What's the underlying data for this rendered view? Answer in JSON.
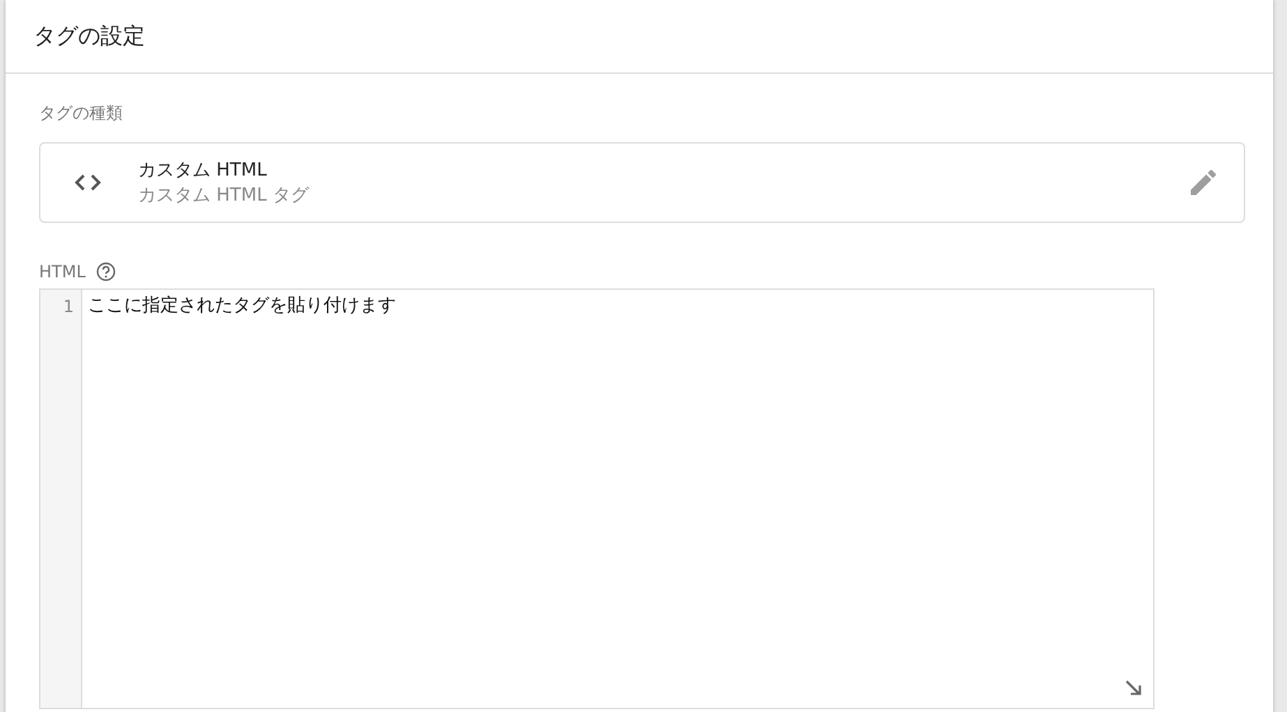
{
  "header": {
    "title": "タグの設定"
  },
  "tag_type": {
    "label": "タグの種類",
    "name": "カスタム HTML",
    "description": "カスタム HTML タグ"
  },
  "html": {
    "label": "HTML",
    "lines": [
      {
        "number": "1",
        "text": "ここに指定されたタグを貼り付けます"
      }
    ]
  }
}
